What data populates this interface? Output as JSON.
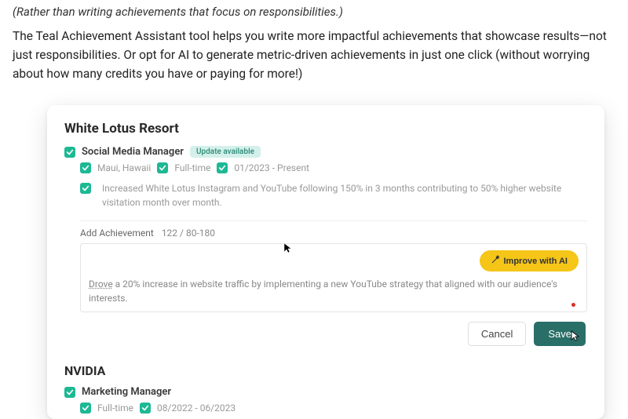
{
  "intro": {
    "caption": "(Rather than writing achievements that focus on responsibilities.)",
    "desc": "The Teal Achievement Assistant tool helps you write more impactful achievements that showcase results—not just responsibilities. Or opt for AI to generate metric-driven achievements in just one click (without worrying about how many credits you have or paying for more!)"
  },
  "job1": {
    "company": "White Lotus Resort",
    "title": "Social Media Manager",
    "update_badge": "Update available",
    "location": "Maui, Hawaii",
    "type": "Full-time",
    "dates": "01/2023 - Present",
    "achievement_existing": "Increased White Lotus Instagram and YouTube following 150% in 3 months contributing to 50% higher website visitation month over month."
  },
  "editor": {
    "label": "Add Achievement",
    "count": "122 / 80-180",
    "improve_label": "Improve with AI",
    "text_prefix": "Drove",
    "text_rest": " a 20% increase in website traffic by implementing a new YouTube strategy that aligned with our audience's interests."
  },
  "actions": {
    "cancel": "Cancel",
    "save": "Save"
  },
  "job2": {
    "company": "NVIDIA",
    "title": "Marketing Manager",
    "type": "Full-time",
    "dates": "08/2022 - 06/2023"
  }
}
